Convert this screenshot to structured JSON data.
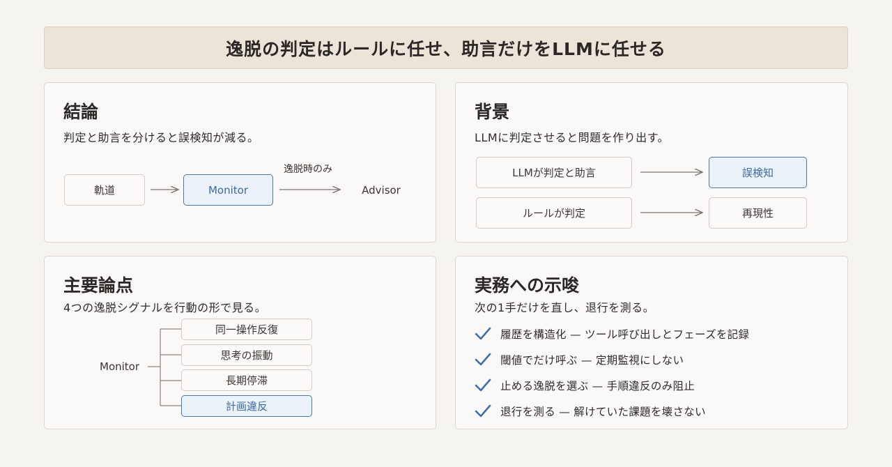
{
  "banner": {
    "title": "逸脱の判定はルールに任せ、助言だけをLLMに任せる"
  },
  "conclusion": {
    "title": "結論",
    "subtitle": "判定と助言を分けると誤検知が減る。",
    "nodes": [
      "軌道",
      "Monitor",
      "Advisor"
    ],
    "edge_label": "逸脱時のみ"
  },
  "background": {
    "title": "背景",
    "subtitle": "LLMに判定させると問題を作り出す。",
    "rows": [
      {
        "from": "LLMが判定と助言",
        "to": "誤検知"
      },
      {
        "from": "ルールが判定",
        "to": "再現性"
      }
    ]
  },
  "key_points": {
    "title": "主要論点",
    "subtitle": "4つの逸脱シグナルを行動の形で見る。",
    "root": "Monitor",
    "items": [
      "同一操作反復",
      "思考の振動",
      "長期停滞",
      "計画違反"
    ]
  },
  "implications": {
    "title": "実務への示唆",
    "subtitle": "次の1手だけを直し、退行を測る。",
    "items": [
      "履歴を構造化 — ツール呼び出しとフェーズを記録",
      "閾値でだけ呼ぶ — 定期監視にしない",
      "止める逸脱を選ぶ — 手順違反のみ阻止",
      "退行を測る — 解けていた課題を壊さない"
    ]
  },
  "colors": {
    "accent": "#4a76ad",
    "banner_bg": "#ece4d9",
    "page_bg": "#f6f4f0"
  }
}
